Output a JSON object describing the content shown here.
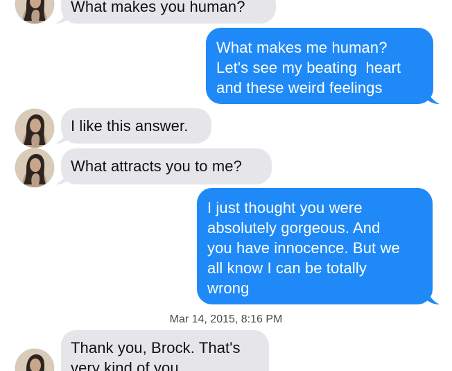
{
  "conversation": {
    "messages": [
      {
        "direction": "incoming",
        "text": "What makes you human?"
      },
      {
        "direction": "outgoing",
        "text": "What makes me human?\nLet's see my beating  heart\nand these weird feelings"
      },
      {
        "direction": "incoming",
        "text": "I like this answer."
      },
      {
        "direction": "incoming",
        "text": "What attracts you to me?"
      },
      {
        "direction": "outgoing",
        "text": "I just thought you were\nabsolutely gorgeous. And\nyou have innocence. But we\nall know I can be totally\nwrong"
      },
      {
        "direction": "incoming",
        "text": "Thank you, Brock. That's\nvery kind of you."
      }
    ],
    "timestamp": "Mar 14, 2015, 8:16 PM"
  },
  "colors": {
    "incoming_bubble": "#e6e6ea",
    "outgoing_bubble": "#1f8af7",
    "incoming_text": "#111111",
    "outgoing_text": "#ffffff",
    "timestamp_text": "#4a4a4a"
  },
  "icons": {
    "avatar": "contact-photo"
  }
}
